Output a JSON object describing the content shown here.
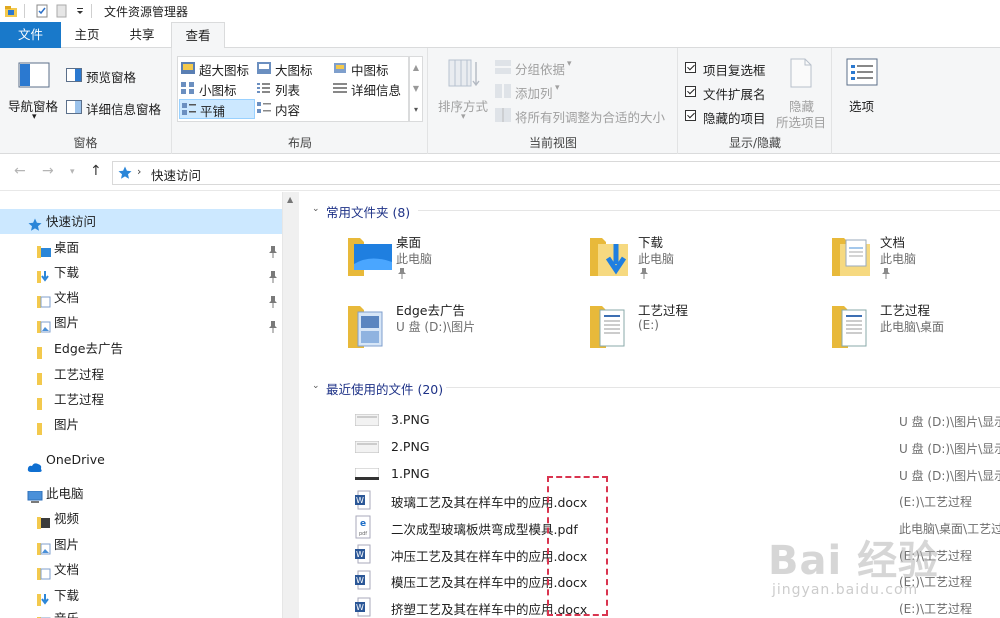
{
  "window": {
    "title": "文件资源管理器"
  },
  "tabs": [
    {
      "label": "文件"
    },
    {
      "label": "主页"
    },
    {
      "label": "共享"
    },
    {
      "label": "查看"
    }
  ],
  "ribbon": {
    "pane_group": {
      "nav_pane": "导航窗格",
      "preview_pane": "预览窗格",
      "details_pane": "详细信息窗格",
      "label": "窗格"
    },
    "layout_group": {
      "items": [
        "超大图标",
        "大图标",
        "中图标",
        "小图标",
        "列表",
        "详细信息",
        "平铺",
        "内容"
      ],
      "selected": "平铺",
      "label": "布局"
    },
    "current_view_group": {
      "sort_by": "排序方式",
      "group_by": "分组依据",
      "add_column": "添加列",
      "fit_columns": "将所有列调整为合适的大小",
      "label": "当前视图"
    },
    "show_hide_group": {
      "item_checkboxes": "项目复选框",
      "file_extensions": "文件扩展名",
      "hidden_items": "隐藏的项目",
      "hide_selected_line1": "隐藏",
      "hide_selected_line2": "所选项目",
      "label": "显示/隐藏"
    },
    "options": "选项"
  },
  "address": {
    "path": "快速访问"
  },
  "left_pane": {
    "quick_access": "快速访问",
    "quick_items": [
      {
        "label": "桌面",
        "pinned": true
      },
      {
        "label": "下载",
        "pinned": true
      },
      {
        "label": "文档",
        "pinned": true
      },
      {
        "label": "图片",
        "pinned": true
      },
      {
        "label": "Edge去广告",
        "pinned": false
      },
      {
        "label": "工艺过程",
        "pinned": false
      },
      {
        "label": "工艺过程",
        "pinned": false
      },
      {
        "label": "图片",
        "pinned": false
      }
    ],
    "onedrive": "OneDrive",
    "this_pc": "此电脑",
    "pc_items": [
      "视频",
      "图片",
      "文档",
      "下载",
      "音乐"
    ]
  },
  "content": {
    "frequent": {
      "header": "常用文件夹 (8)",
      "items": [
        {
          "name": "桌面",
          "sub": "此电脑"
        },
        {
          "name": "下载",
          "sub": "此电脑"
        },
        {
          "name": "文档",
          "sub": "此电脑"
        },
        {
          "name": "Edge去广告",
          "sub": "U 盘 (D:)\\图片"
        },
        {
          "name": "工艺过程",
          "sub": "(E:)"
        },
        {
          "name": "工艺过程",
          "sub": "此电脑\\桌面"
        }
      ]
    },
    "recent": {
      "header": "最近使用的文件 (20)",
      "items": [
        {
          "name": "3.PNG",
          "path": "U 盘 (D:)\\图片\\显示"
        },
        {
          "name": "2.PNG",
          "path": "U 盘 (D:)\\图片\\显示"
        },
        {
          "name": "1.PNG",
          "path": "U 盘 (D:)\\图片\\显示"
        },
        {
          "name": "玻璃工艺及其在样车中的应用.docx",
          "path": "(E:)\\工艺过程"
        },
        {
          "name": "二次成型玻璃板烘弯成型模具.pdf",
          "path": "此电脑\\桌面\\工艺过程"
        },
        {
          "name": "冲压工艺及其在样车中的应用.docx",
          "path": "(E:)\\工艺过程"
        },
        {
          "name": "模压工艺及其在样车中的应用.docx",
          "path": "(E:)\\工艺过程"
        },
        {
          "name": "挤塑工艺及其在样车中的应用.docx",
          "path": "(E:)\\工艺过程"
        }
      ]
    }
  },
  "watermark": {
    "main": "Bai 经验",
    "sub": "jingyan.baidu.com"
  },
  "colors": {
    "accent": "#1979ca",
    "selection": "#cce8ff",
    "folder": "#f3c94d",
    "section": "#1e3287"
  }
}
